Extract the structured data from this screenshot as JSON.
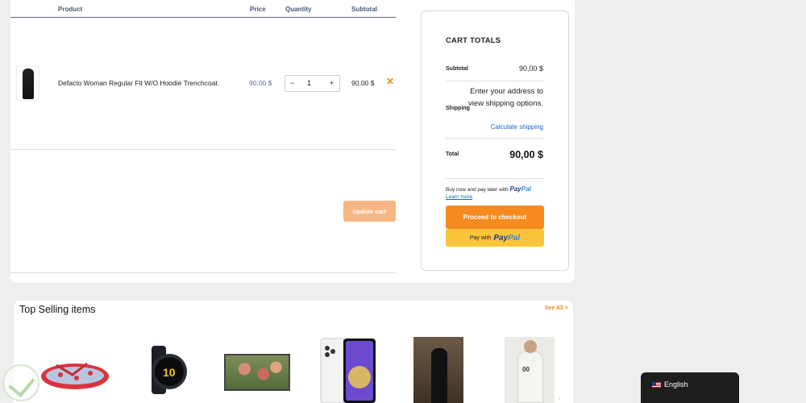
{
  "cart_table": {
    "headers": {
      "product": "Product",
      "price": "Price",
      "quantity": "Quantity",
      "subtotal": "Subtotal"
    },
    "items": [
      {
        "name": "Defacto Woman Regular Fit W/O Hoodie Trenchcoat.",
        "price": "90,00 $",
        "quantity": "1",
        "subtotal": "90,00 $",
        "remove_icon": "close-icon"
      }
    ],
    "qty_minus": "−",
    "qty_plus": "+",
    "remove_glyph": "✕",
    "update_label": "Update cart"
  },
  "cart_totals": {
    "title": "CART TOTALS",
    "subtotal_label": "Subtotal",
    "subtotal_value": "90,00 $",
    "shipping_label": "Shipping",
    "shipping_text": "Enter your address to view shipping options.",
    "calculate_shipping": "Calculate shipping",
    "total_label": "Total",
    "total_value": "90,00 $",
    "paylater_text": "Buy now and pay later with",
    "paypal_pay": "Pay",
    "paypal_pal": "Pal",
    "learn_more": "Learn more",
    "checkout_label": "Proceed to checkout",
    "paypal_button_prefix": "Pay with"
  },
  "top_selling": {
    "title": "Top Selling items",
    "see_all": "See All >",
    "watch_display": "10",
    "hoodie_print": "00"
  },
  "language": {
    "label": "English",
    "flag_icon": "us-flag-icon"
  },
  "colors": {
    "accent": "#f58a1f",
    "link": "#1a66c2",
    "paypal_yellow": "#fcc43a"
  }
}
